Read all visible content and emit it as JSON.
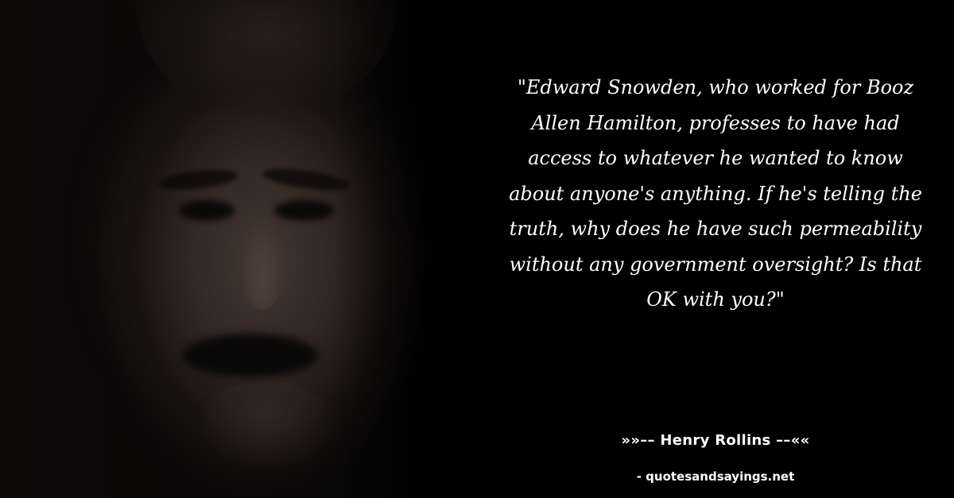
{
  "quote": {
    "text": "\"Edward Snowden, who worked for Booz Allen Hamilton, professes to have had access to whatever he wanted to know about anyone's anything. If he's telling the truth, why does he have such permeability without any government oversight? Is that OK with you?\""
  },
  "attribution": {
    "author_line": "»»–– Henry Rollins ––««",
    "site": "- quotesandsayings.net"
  },
  "colors": {
    "background": "#000000",
    "text": "#ffffff"
  }
}
